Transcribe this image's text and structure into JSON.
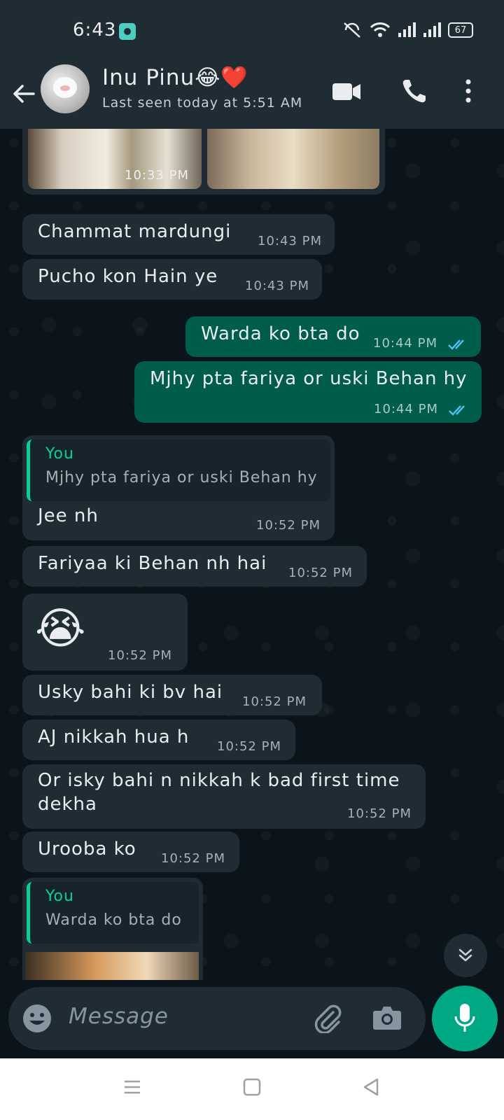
{
  "status_bar": {
    "time": "6:43",
    "battery": "67"
  },
  "header": {
    "contact_name": "Inu Pinu😂❤️",
    "last_seen": "Last seen today at 5:51 AM"
  },
  "messages": [
    {
      "id": "photos",
      "type": "photos",
      "time": "10:33 PM"
    },
    {
      "id": "m1",
      "dir": "in",
      "text": "Chammat mardungi",
      "time": "10:43 PM"
    },
    {
      "id": "m2",
      "dir": "in",
      "text": "Pucho kon Hain ye",
      "time": "10:43 PM"
    },
    {
      "id": "m3",
      "dir": "out",
      "text": "Warda ko bta do",
      "time": "10:44 PM"
    },
    {
      "id": "m4",
      "dir": "out",
      "text": "Mjhy pta fariya or uski Behan hy",
      "time": "10:44 PM"
    },
    {
      "id": "m5",
      "dir": "in",
      "quote_author": "You",
      "quote_text": "Mjhy pta fariya or uski Behan hy",
      "text": "Jee nh",
      "time": "10:52 PM"
    },
    {
      "id": "m6",
      "dir": "in",
      "text": "Fariyaa ki Behan nh hai",
      "time": "10:52 PM"
    },
    {
      "id": "m7",
      "dir": "in",
      "text": "😭",
      "time": "10:52 PM"
    },
    {
      "id": "m8",
      "dir": "in",
      "text": "Usky bahi ki bv hai",
      "time": "10:52 PM"
    },
    {
      "id": "m9",
      "dir": "in",
      "text": "AJ nikkah hua h",
      "time": "10:52 PM"
    },
    {
      "id": "m10",
      "dir": "in",
      "text_line1": "Or isky bahi n nikkah k bad first time",
      "text_line2": "dekha",
      "time": "10:52 PM"
    },
    {
      "id": "m11",
      "dir": "in",
      "text": "Urooba ko",
      "time": "10:52 PM"
    },
    {
      "id": "m12",
      "dir": "in",
      "quote_author": "You",
      "quote_text": "Warda ko bta do"
    }
  ],
  "composer": {
    "placeholder": "Message"
  },
  "colors": {
    "incoming_bubble": "#1f2c34",
    "outgoing_bubble": "#005c4b",
    "accent": "#00a884",
    "read_ticks": "#53bdeb"
  },
  "icons": [
    "back-arrow-icon",
    "video-call-icon",
    "voice-call-icon",
    "more-options-icon",
    "emoji-icon",
    "attach-icon",
    "camera-icon",
    "mic-icon",
    "scroll-down-icon"
  ]
}
